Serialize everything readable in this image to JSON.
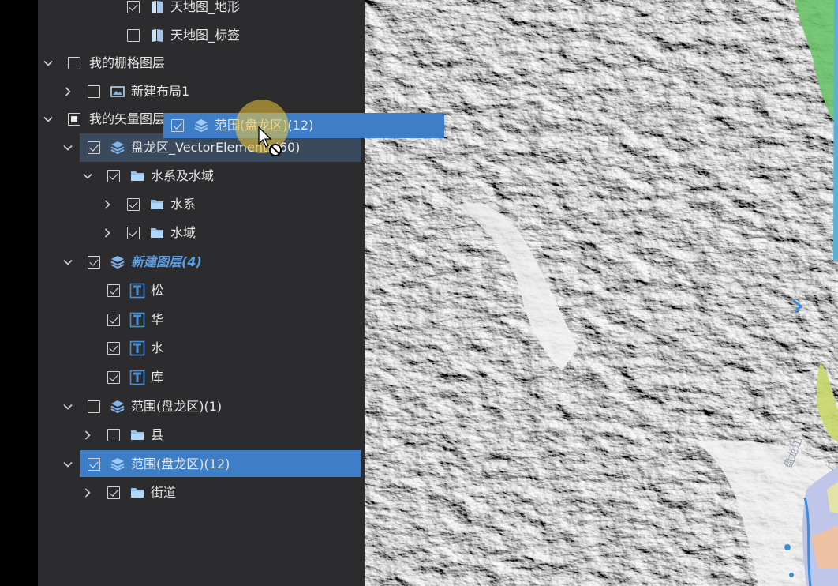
{
  "layer_tree": {
    "rows": [
      {
        "id": "tdt-dixing",
        "label": "天地图_地形",
        "checked": "checked",
        "expanded": null,
        "icon": "map-book-icon"
      },
      {
        "id": "tdt-biaoqian",
        "label": "天地图_标签",
        "checked": "unchecked",
        "expanded": null,
        "icon": "map-book-icon"
      },
      {
        "id": "raster-group",
        "label": "我的栅格图层",
        "checked": "unchecked",
        "expanded": true,
        "icon": null
      },
      {
        "id": "new-layout",
        "label": "新建布局1",
        "checked": "unchecked",
        "expanded": false,
        "icon": "image-icon"
      },
      {
        "id": "vector-group",
        "label": "我的矢量图层",
        "checked": "indeterminate",
        "expanded": true,
        "icon": null
      },
      {
        "id": "panlong-vector",
        "label": "盘龙区_VectorElements(60)",
        "checked": "checked",
        "expanded": true,
        "icon": "layers-icon"
      },
      {
        "id": "water-group",
        "label": "水系及水域",
        "checked": "checked",
        "expanded": true,
        "icon": "folder-icon"
      },
      {
        "id": "water-system",
        "label": "水系",
        "checked": "checked",
        "expanded": false,
        "icon": "folder-icon"
      },
      {
        "id": "water-area",
        "label": "水域",
        "checked": "checked",
        "expanded": false,
        "icon": "folder-icon"
      },
      {
        "id": "new-layer",
        "label": "新建图层(4)",
        "checked": "checked",
        "expanded": true,
        "icon": "layers-icon"
      },
      {
        "id": "text-song",
        "label": "松",
        "checked": "checked",
        "expanded": null,
        "icon": "text-icon"
      },
      {
        "id": "text-hua",
        "label": "华",
        "checked": "checked",
        "expanded": null,
        "icon": "text-icon"
      },
      {
        "id": "text-shui",
        "label": "水",
        "checked": "checked",
        "expanded": null,
        "icon": "text-icon"
      },
      {
        "id": "text-ku",
        "label": "库",
        "checked": "checked",
        "expanded": null,
        "icon": "text-icon"
      },
      {
        "id": "range-1",
        "label": "范围(盘龙区)(1)",
        "checked": "unchecked",
        "expanded": true,
        "icon": "layers-icon"
      },
      {
        "id": "county",
        "label": "县",
        "checked": "unchecked",
        "expanded": false,
        "icon": "folder-icon"
      },
      {
        "id": "range-12",
        "label": "范围(盘龙区)(12)",
        "checked": "checked",
        "expanded": true,
        "icon": "layers-icon"
      },
      {
        "id": "street",
        "label": "街道",
        "checked": "checked",
        "expanded": false,
        "icon": "folder-icon"
      }
    ]
  },
  "drag_ghost": {
    "label": "范围(盘龙区)(12)",
    "checked": "checked",
    "icon": "layers-icon"
  },
  "map": {
    "river_label": "盘龙江"
  },
  "colors": {
    "panel_bg": "#2c2c2e",
    "selected_bg": "#3d7ec7",
    "drop_target_bg": "#3a4a5c",
    "icon_blue": "#4a90d9",
    "italic_label": "#5a9fe6",
    "cursor_halo": "#f0c83c"
  }
}
